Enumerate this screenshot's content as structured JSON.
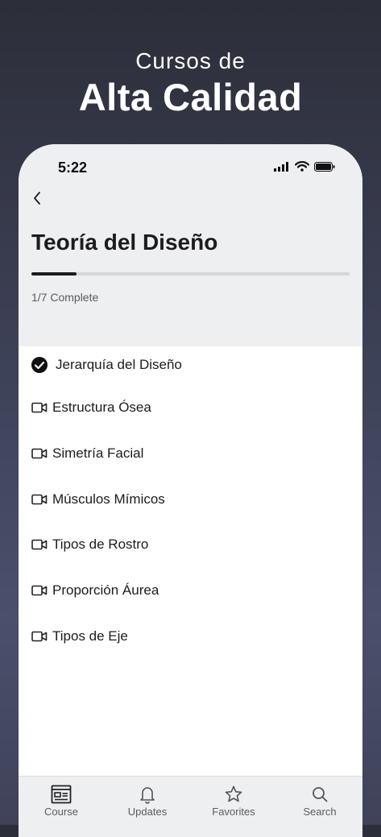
{
  "promo": {
    "subtitle": "Cursos de",
    "title": "Alta Calidad"
  },
  "status_bar": {
    "time": "5:22"
  },
  "course": {
    "title": "Teoría del Diseño",
    "progress_fraction": 0.143,
    "progress_text": "1/7 Complete"
  },
  "lessons": [
    {
      "label": "Jerarquía del Diseño",
      "icon": "check-circle-icon",
      "completed": true
    },
    {
      "label": "Estructura Ósea",
      "icon": "video-icon",
      "completed": false
    },
    {
      "label": "Simetría Facial",
      "icon": "video-icon",
      "completed": false
    },
    {
      "label": "Músculos Mímicos",
      "icon": "video-icon",
      "completed": false
    },
    {
      "label": "Tipos de Rostro",
      "icon": "video-icon",
      "completed": false
    },
    {
      "label": "Proporción Áurea",
      "icon": "video-icon",
      "completed": false
    },
    {
      "label": "Tipos de Eje",
      "icon": "video-icon",
      "completed": false
    }
  ],
  "tabbar": {
    "tabs": [
      {
        "label": "Course",
        "icon": "course-icon"
      },
      {
        "label": "Updates",
        "icon": "bell-icon"
      },
      {
        "label": "Favorites",
        "icon": "star-icon"
      },
      {
        "label": "Search",
        "icon": "search-icon"
      }
    ]
  },
  "colors": {
    "background_top": "#2c2e39",
    "background_mid": "#4b4f6c",
    "surface": "#eeeff1",
    "text_primary": "#1c1c1e",
    "text_secondary": "#5b5b60"
  }
}
